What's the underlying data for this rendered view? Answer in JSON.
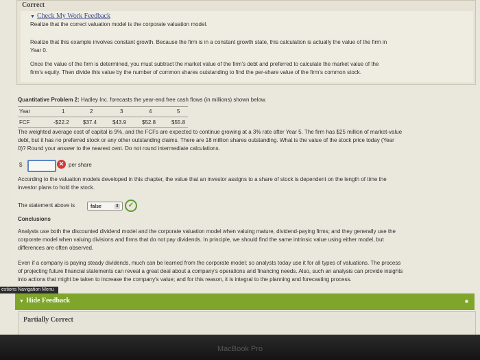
{
  "feedback": {
    "header": "Correct",
    "link": "Check My Work Feedback",
    "line1": "Realize that the correct valuation model is the corporate valuation model.",
    "line2a": "Realize that this example involves constant growth. Because the firm is in a constant growth state, this calculation is actually the value of the firm in",
    "line2b": "Year 0.",
    "line3a": "Once the value of the firm is determined, you must subtract the market value of the firm's debt and preferred to calculate the market value of the",
    "line3b": "firm's equity. Then divide this value by the number of common shares outstanding to find the per-share value of the firm's common stock."
  },
  "problem": {
    "title": "Quantitative Problem 2:",
    "title_rest": " Hadley Inc. forecasts the year-end free cash flows (in millions) shown below.",
    "table": {
      "year_label": "Year",
      "years": [
        "1",
        "2",
        "3",
        "4",
        "5"
      ],
      "fcf_label": "FCF",
      "fcf": [
        "-$22.2",
        "$37.4",
        "$43.9",
        "$52.8",
        "$55.8"
      ]
    },
    "desc1": "The weighted average cost of capital is 9%, and the FCFs are expected to continue growing at a 3% rate after Year 5. The firm has $25 million of market-value",
    "desc2": "debt, but it has no preferred stock or any other outstanding claims. There are 18 million shares outstanding. What is the value of the stock price today (Year",
    "desc3": "0)? Round your answer to the nearest cent. Do not round intermediate calculations.",
    "currency": "$",
    "answer_value": "",
    "answer_unit": "per share",
    "statement1": "According to the valuation models developed in this chapter, the value that an investor assigns to a share of stock is dependent on the length of time the",
    "statement2": "investor plans to hold the stock.",
    "statement_label": "The statement above is",
    "statement_choice": "false",
    "conclusions_title": "Conclusions",
    "c1": "Analysts use both the discounted dividend model and the corporate valuation model when valuing mature, dividend-paying firms; and they generally use the",
    "c2": "corporate model when valuing divisions and firms that do not pay dividends. In principle, we should find the same intrinsic value using either model, but",
    "c3": "differences are often observed.",
    "c4": "Even if a company is paying steady dividends, much can be learned from the corporate model; so analysts today use it for all types of valuations. The process",
    "c5": "of projecting future financial statements can reveal a great deal about a company's operations and financing needs. Also, such an analysis can provide insights",
    "c6": "into actions that might be taken to increase the company's value; and for this reason, it is integral to the planning and forecasting process."
  },
  "nav_menu": "estions Navigation Menu",
  "hide_feedback": "Hide Feedback",
  "partially_correct": "Partially Correct",
  "bezel_label": "MacBook Pro",
  "colors": {
    "accent_green": "#7fa52a",
    "error_red": "#d23a3a",
    "input_blue": "#5a86c8"
  }
}
